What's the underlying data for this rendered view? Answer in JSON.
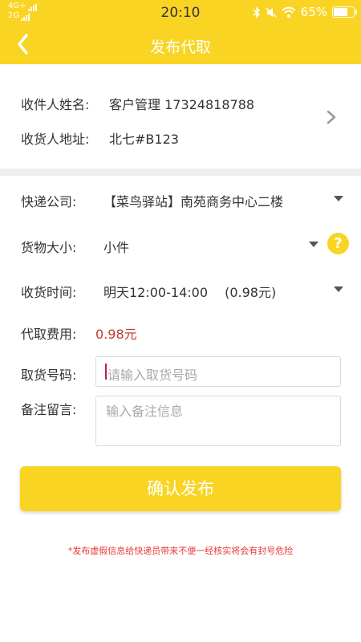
{
  "status_bar": {
    "network_top": "4G+",
    "network_bottom": "2G",
    "time": "20:10",
    "battery": "65%",
    "icons": [
      "signal-icon",
      "bluetooth-icon",
      "mute-icon",
      "wifi-icon",
      "battery-icon"
    ]
  },
  "header": {
    "title": "发布代取",
    "back_icon": "chevron-left-icon"
  },
  "recipient": {
    "name_label": "收件人姓名:",
    "name_value": "客户管理 17324818788",
    "address_label": "收货人地址:",
    "address_value": "北七#B123"
  },
  "form": {
    "courier_label": "快递公司:",
    "courier_value": "【菜鸟驿站】南苑商务中心二楼",
    "size_label": "货物大小:",
    "size_value": "小件",
    "time_label": "收货时间:",
    "time_value": "明天12:00-14:00　 (0.98元)",
    "fee_label": "代取费用:",
    "fee_value": "0.98元",
    "code_label": "取货号码:",
    "code_placeholder": "请输入取货号码",
    "note_label": "备注留言:",
    "note_placeholder": "输入备注信息",
    "help_symbol": "?"
  },
  "submit_label": "确认发布",
  "warning": "*发布虚假信息给快递员带来不便一经核实将会有封号危险",
  "colors": {
    "accent": "#f9d423",
    "warning": "#e53935",
    "fee": "#c0392b"
  }
}
